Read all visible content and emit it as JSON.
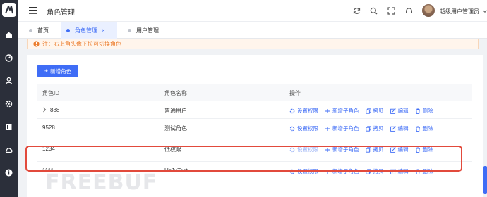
{
  "app": {
    "title": "角色管理"
  },
  "header": {
    "username": "超级用户管理员"
  },
  "tabs": [
    {
      "label": "首页"
    },
    {
      "label": "角色管理",
      "close": "×"
    },
    {
      "label": "用户管理"
    }
  ],
  "notice": {
    "text": "注：右上角头像下拉可切换角色"
  },
  "toolbar": {
    "add_label": "新增角色",
    "add_icon": "+"
  },
  "table": {
    "columns": [
      "角色ID",
      "角色名称",
      "操作"
    ],
    "rows": [
      {
        "id": "888",
        "name": "普通用户",
        "expandable": true
      },
      {
        "id": "9528",
        "name": "测试角色"
      },
      {
        "id": "1234",
        "name": "低权限"
      },
      {
        "id": "1111",
        "name": "UzJuTest"
      }
    ],
    "actions": [
      "设置权限",
      "新增子角色",
      "拷贝",
      "编辑",
      "删除"
    ]
  },
  "watermark": "FREEBUF",
  "colors": {
    "accent": "#3f6df6",
    "sidebar": "#2b2f3a",
    "highlight": "#e24a3c",
    "notice": "#ec7d2d"
  }
}
